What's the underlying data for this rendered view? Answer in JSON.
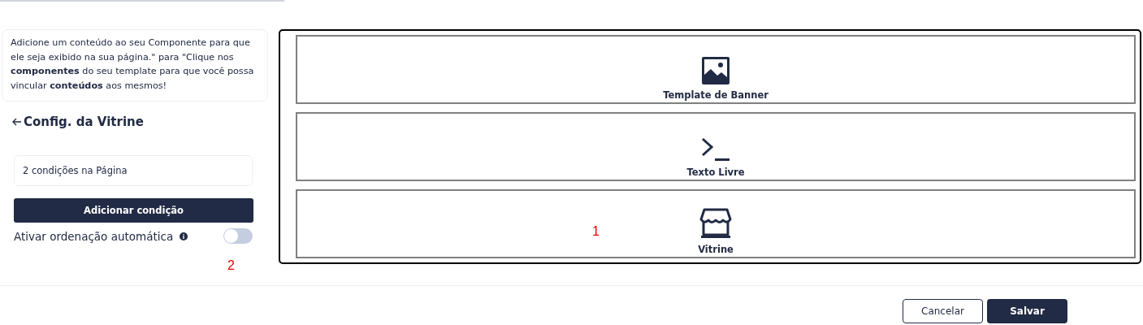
{
  "info": "Adicione um conteúdo ao seu Componente para que ele seja exibido na sua página.\" para \"Clique nos **componentes** do seu template para que você possa vincular **conteúdos** aos mesmos!",
  "back_title": "Config. da Vitrine",
  "conditions_field": {
    "value": "2 condições na Página"
  },
  "add_condition_button": "Adicionar condição",
  "auto_sort": {
    "label": "Ativar ordenação automática",
    "on": false
  },
  "components": [
    {
      "kind": "image",
      "label": "Template de Banner"
    },
    {
      "kind": "terminal",
      "label": "Texto Livre"
    },
    {
      "kind": "store",
      "label": "Vitrine"
    }
  ],
  "markers": [
    {
      "text": "1"
    },
    {
      "text": "2"
    }
  ],
  "buttons": {
    "cancel": "Cancelar",
    "save": "Salvar"
  }
}
